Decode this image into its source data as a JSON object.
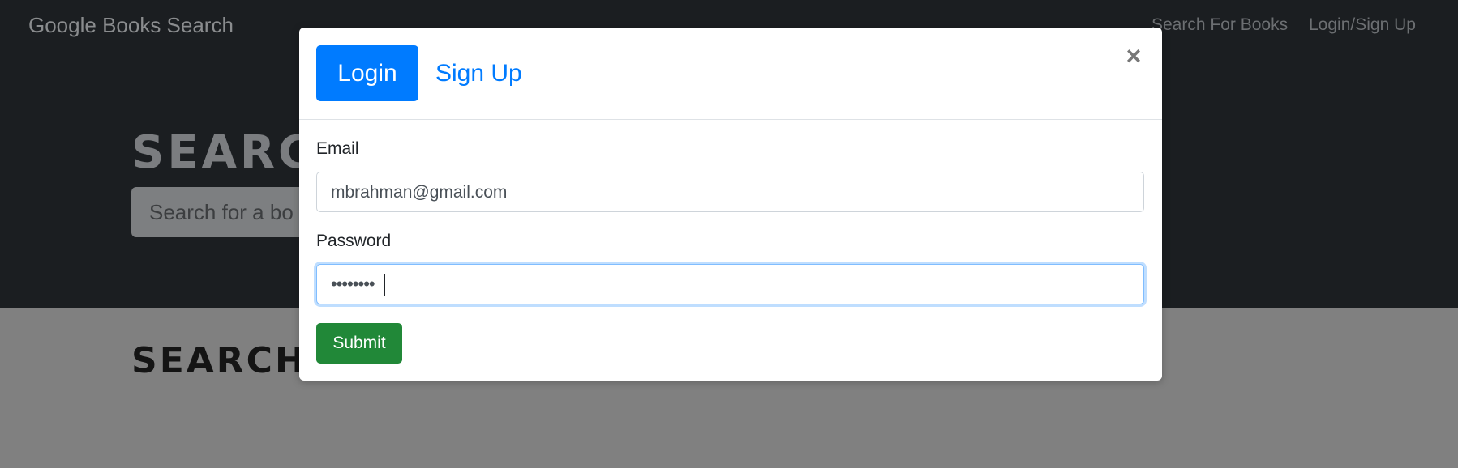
{
  "navbar": {
    "brand": "Google Books Search",
    "links": [
      "Search For Books",
      "Login/Sign Up"
    ]
  },
  "hero": {
    "title_visible": "SEARC",
    "search_placeholder_visible": "Search for a bo"
  },
  "results": {
    "title_visible": "SEARCH"
  },
  "modal": {
    "tabs": {
      "login": "Login",
      "signup": "Sign Up"
    },
    "close_symbol": "×",
    "email": {
      "label": "Email",
      "value": "mbrahman@gmail.com"
    },
    "password": {
      "label": "Password",
      "masked_value": "••••••••"
    },
    "submit_label": "Submit"
  },
  "colors": {
    "primary": "#007bff",
    "success": "#218838",
    "navbar_bg": "#1b1e21",
    "overlay_bg": "#808080"
  }
}
